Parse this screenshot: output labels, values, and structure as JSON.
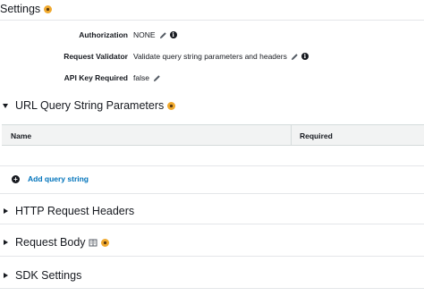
{
  "settings": {
    "title": "Settings"
  },
  "fields": [
    {
      "label": "Authorization",
      "value": "NONE"
    },
    {
      "label": "Request Validator",
      "value": "Validate query string parameters and headers"
    },
    {
      "label": "API Key Required",
      "value": "false"
    }
  ],
  "query_params": {
    "title": "URL Query String Parameters",
    "columns": [
      "Name",
      "Required"
    ],
    "add_label": "Add query string"
  },
  "sections": [
    {
      "title": "HTTP Request Headers"
    },
    {
      "title": "Request Body"
    },
    {
      "title": "SDK Settings"
    }
  ],
  "icons": {
    "help": "help-info-icon",
    "edit": "pencil-icon",
    "info": "info-circle-icon",
    "add": "plus-circle-icon",
    "model": "book-icon"
  },
  "colors": {
    "link": "#0073bb",
    "help_dot": "#f0a92e",
    "header_bg": "#f2f3f3"
  }
}
